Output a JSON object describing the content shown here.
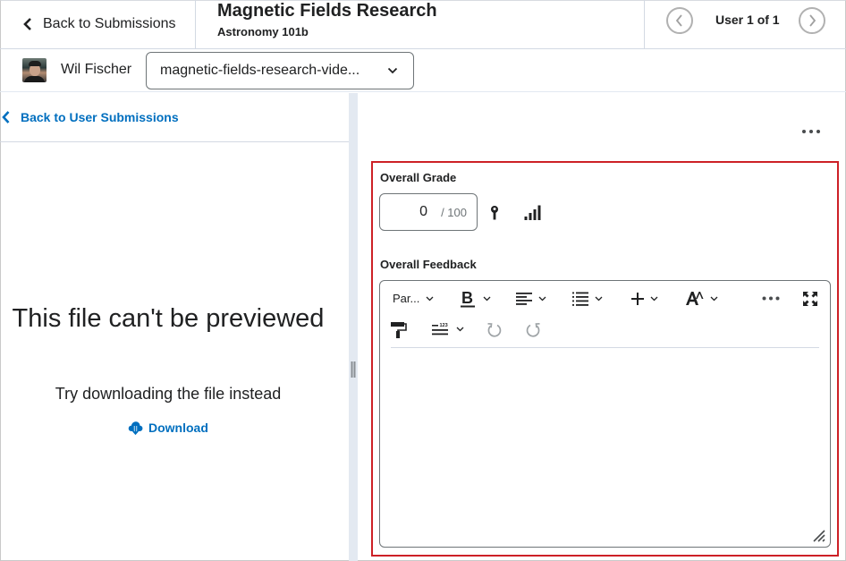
{
  "header": {
    "back_label": "Back to Submissions",
    "title": "Magnetic Fields Research",
    "subtitle": "Astronomy 101b",
    "user_counter": "User 1 of 1"
  },
  "userbar": {
    "user_name": "Wil Fischer",
    "file_selected": "magnetic-fields-research-vide..."
  },
  "left_panel": {
    "back_label": "Back to User Submissions",
    "preview_message": "This file can't be previewed",
    "download_hint": "Try downloading the file instead",
    "download_label": "Download"
  },
  "grading": {
    "grade_label": "Overall Grade",
    "score": "0",
    "out_of": "/ 100",
    "feedback_label": "Overall Feedback",
    "editor_content": ""
  },
  "editor_toolbar": {
    "paragraph_style": "Par...",
    "buttons": [
      "bold",
      "align",
      "list",
      "insert",
      "text-style",
      "more",
      "fullscreen",
      "format-painter",
      "line-spacing",
      "undo",
      "redo"
    ]
  },
  "colors": {
    "link": "#006fbf",
    "highlight": "#cd2026",
    "divider": "#e3e9f1"
  }
}
